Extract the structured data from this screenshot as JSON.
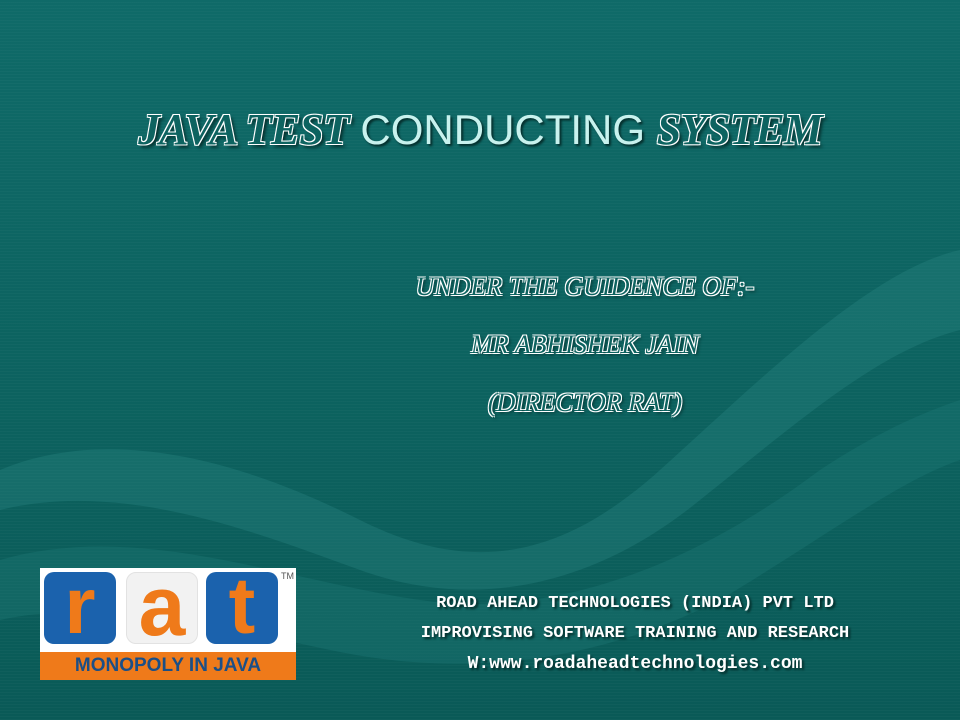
{
  "slide": {
    "title_parts": [
      "JAVA TEST",
      " CONDUCTING ",
      "SYSTEM"
    ],
    "guidance_lines": [
      "UNDER THE GUIDENCE OF:-",
      "MR ABHISHEK JAIN",
      "(DIRECTOR RAT)"
    ],
    "logo": {
      "letters": [
        "r",
        "a",
        "t"
      ],
      "trademark": "TM",
      "tagline": "MONOPOLY IN JAVA"
    },
    "company_lines": [
      "ROAD AHEAD TECHNOLOGIES (INDIA) PVT LTD",
      "IMPROVISING SOFTWARE TRAINING AND RESEARCH",
      "W:www.roadaheadtechnologies.com"
    ]
  },
  "colors": {
    "background": "#0c625f",
    "title_light": "#c8f2ee",
    "logo_blue": "#1b62ad",
    "logo_orange": "#ef7a1a"
  }
}
